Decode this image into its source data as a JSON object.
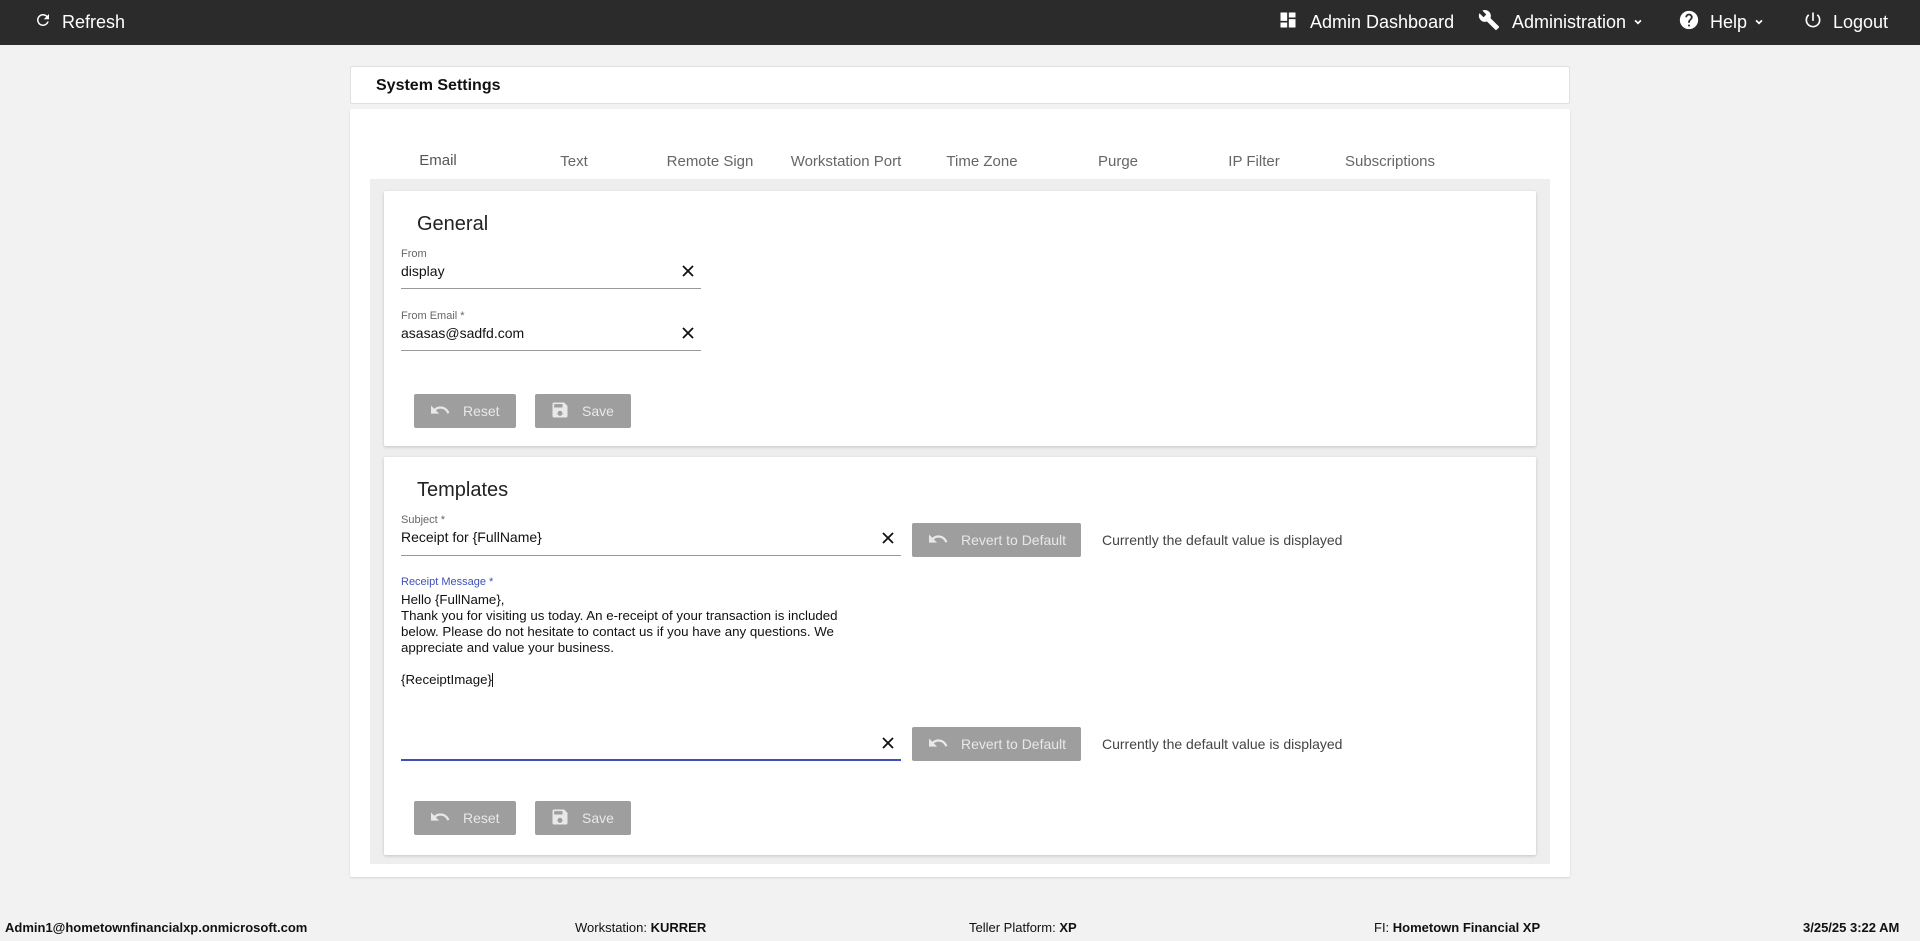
{
  "topbar": {
    "refresh_label": "Refresh",
    "admin_dashboard_label": "Admin Dashboard",
    "administration_label": "Administration",
    "help_label": "Help",
    "logout_label": "Logout",
    "icons": [
      "refresh-icon",
      "dashboard-icon",
      "wrench-icon",
      "help-circle-icon",
      "power-icon",
      "chevron-down-icon"
    ]
  },
  "page": {
    "title": "System Settings"
  },
  "tabs": [
    {
      "label": "Email",
      "active": true
    },
    {
      "label": "Text",
      "active": false
    },
    {
      "label": "Remote Sign",
      "active": false
    },
    {
      "label": "Workstation Port",
      "active": false
    },
    {
      "label": "Time Zone",
      "active": false
    },
    {
      "label": "Purge",
      "active": false
    },
    {
      "label": "IP Filter",
      "active": false
    },
    {
      "label": "Subscriptions",
      "active": false
    }
  ],
  "general": {
    "title": "General",
    "from": {
      "label": "From",
      "value": "display"
    },
    "from_email": {
      "label": "From Email *",
      "value": "asasas@sadfd.com"
    },
    "reset_label": "Reset",
    "save_label": "Save"
  },
  "templates": {
    "title": "Templates",
    "subject": {
      "label": "Subject *",
      "value": "Receipt for {FullName}"
    },
    "receipt_message": {
      "label": "Receipt Message *",
      "lines": [
        "Hello {FullName},",
        "Thank you for visiting us today. An e-receipt of your transaction is included",
        "below. Please do not hesitate to contact us if you have any questions. We",
        "appreciate and value your business.",
        "",
        "{ReceiptImage}"
      ]
    },
    "revert_label": "Revert to Default",
    "default_note": "Currently the default value is displayed",
    "reset_label": "Reset",
    "save_label": "Save"
  },
  "statusbar": {
    "user": "Admin1@hometownfinancialxp.onmicrosoft.com",
    "workstation_label": "Workstation: ",
    "workstation_value": "KURRER",
    "platform_label": "Teller Platform: ",
    "platform_value": "XP",
    "fi_label": "FI: ",
    "fi_value": "Hometown Financial XP",
    "datetime": "3/25/25 3:22 AM"
  },
  "colors": {
    "topbar_bg": "#2b2b2b",
    "accent": "#3f51b5",
    "button_bg": "#9e9e9e",
    "page_bg": "#f2f2f2"
  }
}
